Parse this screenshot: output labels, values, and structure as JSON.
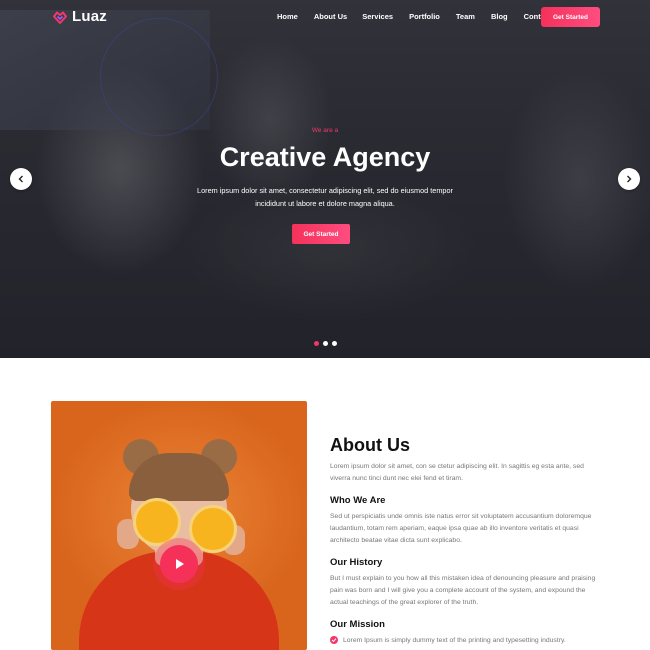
{
  "brand": {
    "name": "Luaz"
  },
  "nav": {
    "items": [
      "Home",
      "About Us",
      "Services",
      "Portfolio",
      "Team",
      "Blog",
      "Contact Us"
    ],
    "cta": "Get Started"
  },
  "hero": {
    "kicker": "We are a",
    "title": "Creative Agency",
    "description": "Lorem ipsum dolor sit amet, consectetur adipiscing elit, sed do eiusmod tempor incididunt ut labore et dolore magna aliqua.",
    "cta": "Get Started",
    "slides": {
      "count": 3,
      "active_index": 0
    }
  },
  "about": {
    "title": "About Us",
    "lead": "Lorem ipsum dolor sit amet, con se ctetur adipiscing elit. In sagittis eg esta ante, sed viverra nunc tinci dunt nec elei fend et tiram.",
    "who_title": "Who We Are",
    "who_text": "Sed ut perspiciatis unde omnis iste natus error sit voluptatem accusantium doloremque laudantium, totam rem aperiam, eaque ipsa quae ab illo inventore veritatis et quasi architecto beatae vitae dicta sunt explicabo.",
    "history_title": "Our History",
    "history_text": "But I must explain to you how all this mistaken idea of denouncing pleasure and praising pain was born and I will give you a complete account of the system, and expound the actual teachings of the great explorer of the truth.",
    "mission_title": "Our Mission",
    "mission_items": [
      "Lorem Ipsum is simply dummy text of the printing and typesetting industry."
    ]
  },
  "colors": {
    "accent": "#f5315a",
    "accent_light": "#ff4d80",
    "image_bg": "#e07a2c"
  },
  "icons": {
    "logo": "heart-diamond-icon",
    "prev": "chevron-left-icon",
    "next": "chevron-right-icon",
    "play": "play-icon",
    "check": "check-circle-icon"
  }
}
